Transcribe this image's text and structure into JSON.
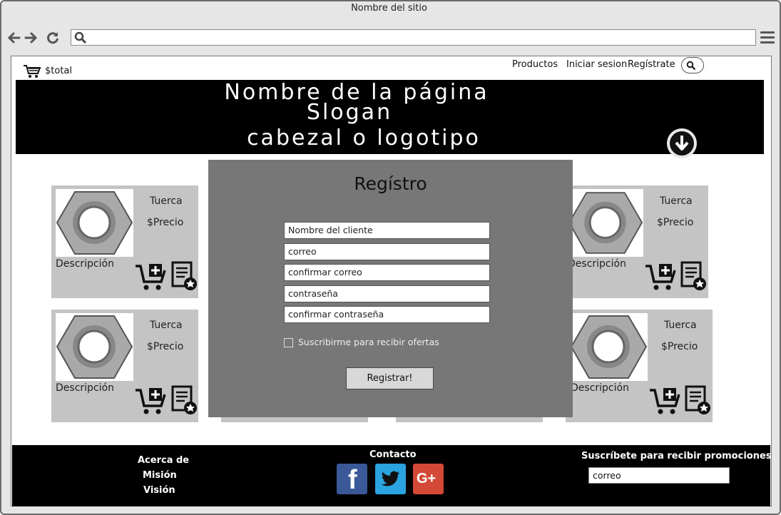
{
  "window": {
    "title": "Nombre del sitio"
  },
  "browser": {
    "url": ""
  },
  "header": {
    "cart_total": "$total",
    "nav": {
      "products": "Productos",
      "login": "Iniciar sesion",
      "register": "Regístrate"
    }
  },
  "banner": {
    "line1": "Nombre de la página",
    "line2": "Slogan",
    "line3": "cabezal o logotipo"
  },
  "products": [
    {
      "name": "Tuerca",
      "price": "$Precio",
      "description": "Descripción"
    },
    {
      "name": "Tuerca",
      "price": "$Precio",
      "description": "Descripción"
    },
    {
      "name": "Tuerca",
      "price": "$Precio",
      "description": "Descripción"
    },
    {
      "name": "Tuerca",
      "price": "$Precio",
      "description": "Descripción"
    }
  ],
  "modal": {
    "title": "Regístro",
    "fields": {
      "name": "Nombre del cliente",
      "email": "correo",
      "confirm_email": "confirmar correo",
      "password": "contraseña",
      "confirm_password": "confirmar contraseña"
    },
    "checkbox_label": "Suscribirme para recibir ofertas",
    "submit_label": "Registrar!"
  },
  "footer": {
    "about": {
      "title": "Acerca de",
      "mission": "Misión",
      "vision": "Visión"
    },
    "contact_title": "Contacto",
    "social": {
      "facebook": "f",
      "googleplus": "G+"
    },
    "subscribe_title": "Suscríbete para recibir promociones",
    "subscribe_value": "correo"
  },
  "icons": [
    "back-arrow-icon",
    "forward-arrow-icon",
    "refresh-icon",
    "search-icon",
    "hamburger-menu-icon",
    "shopping-cart-icon",
    "down-arrow-icon",
    "add-to-cart-icon",
    "wishlist-icon",
    "facebook-icon",
    "twitter-icon",
    "google-plus-icon"
  ],
  "colors": {
    "banner": "#000000",
    "modal": "#777777",
    "card": "#c4c4c4",
    "facebook": "#3b5998",
    "twitter": "#2aa3e0",
    "googleplus": "#d34836"
  }
}
